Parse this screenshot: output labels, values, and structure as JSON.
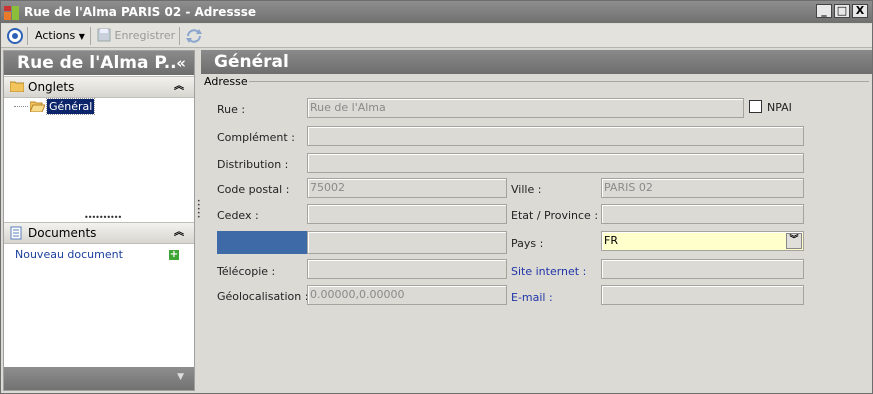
{
  "window": {
    "title": "Rue de l'Alma PARIS 02 -  Adressse",
    "controls": [
      "_",
      "□",
      "X"
    ]
  },
  "toolbar": {
    "actions_label": "Actions",
    "save_label": "Enregistrer"
  },
  "left_pane": {
    "header": "Rue de l'Alma P..",
    "collapse_glyph": "«",
    "tabs_section": {
      "label": "Onglets",
      "nodes": [
        {
          "label": "Général",
          "selected": true
        }
      ]
    },
    "documents_section": {
      "label": "Documents",
      "link": "Nouveau document"
    }
  },
  "main": {
    "header": "Général",
    "group_label": "Adresse",
    "labels": {
      "rue": "Rue :",
      "npai": "NPAI",
      "complement": "Complément :",
      "distribution": "Distribution :",
      "code_postal": "Code postal :",
      "ville": "Ville :",
      "cedex": "Cedex :",
      "etat": "Etat / Province :",
      "pays": "Pays :",
      "telecopie": "Télécopie :",
      "site": "Site internet :",
      "geoloc": "Géolocalisation :",
      "email": "E-mail :"
    },
    "values": {
      "rue": "Rue de l'Alma",
      "npai_checked": false,
      "complement": "",
      "distribution": "",
      "code_postal": "75002",
      "ville": "PARIS 02",
      "cedex": "",
      "etat": "",
      "pays": "FR",
      "telecopie": "",
      "site": "",
      "geoloc": "0.00000,0.00000",
      "email": ""
    }
  },
  "colors": {
    "header_gray": "#7c7c7c",
    "selection_blue": "#0b246a",
    "active_field": "#ffffcc",
    "link_blue": "#2035a8",
    "phone_bar": "#3e6ba8"
  }
}
